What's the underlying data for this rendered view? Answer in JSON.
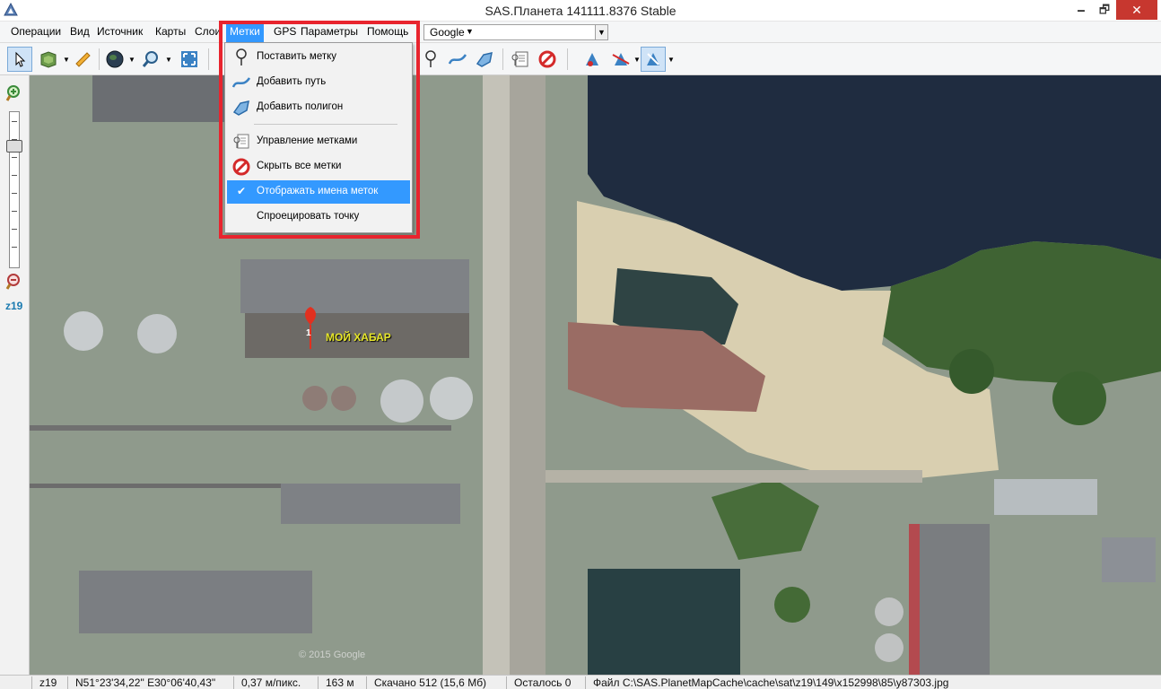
{
  "window": {
    "title": "SAS.Планета 141111.8376 Stable",
    "minimize": "🗕",
    "maximize": "🗗",
    "close": "✕"
  },
  "menubar": {
    "items": [
      "Операции",
      "Вид",
      "Источник",
      "Карты",
      "Слои",
      "Метки",
      "GPS",
      "Параметры",
      "Помощь"
    ],
    "active_index": 5,
    "map_source_select": {
      "value": "Google"
    }
  },
  "toolbar": {
    "buttons": [
      "pointer-icon",
      "layers-icon",
      "ruler-icon",
      "globe-icon",
      "magnifier-icon",
      "fullscreen-icon",
      "placemark-icon",
      "path-icon",
      "polygon-icon",
      "marks-manager-icon",
      "hide-marks-icon",
      "gps-icon",
      "gps-track-icon",
      "gps-follow-icon"
    ]
  },
  "zoom": {
    "label": "z19",
    "level_fraction": 0.82
  },
  "dropdown": {
    "items": [
      {
        "label": "Поставить метку",
        "icon": "placemark-icon"
      },
      {
        "label": "Добавить путь",
        "icon": "path-icon"
      },
      {
        "label": "Добавить полигон",
        "icon": "polygon-icon"
      },
      {
        "label": "Управление метками",
        "icon": "marks-manager-icon"
      },
      {
        "label": "Скрыть все метки",
        "icon": "hide-marks-icon"
      },
      {
        "label": "Отображать имена меток",
        "icon": "check-icon",
        "checked": true,
        "highlighted": true
      },
      {
        "label": "Спроецировать точку",
        "icon": ""
      }
    ]
  },
  "map": {
    "marker": {
      "number": "1",
      "label": "МОЙ ХАБАР"
    },
    "copyright": "© 2015 Google",
    "colors": {
      "water": "#1d2a3e",
      "sand": "#d8cfb2",
      "vegetation": "#4a6b3a",
      "marker": "#e2301f"
    }
  },
  "statusbar": {
    "zoom": "z19",
    "coords": "N51°23'34,22\" E30°06'40,43\"",
    "scale": "0,37 м/пикс.",
    "distance": "163 м",
    "downloaded": "Скачано 512 (15,6 Мб)",
    "remaining": "Осталось 0",
    "file": "Файл C:\\SAS.PlanetMapCache\\cache\\sat\\z19\\149\\x152998\\85\\y87303.jpg"
  }
}
